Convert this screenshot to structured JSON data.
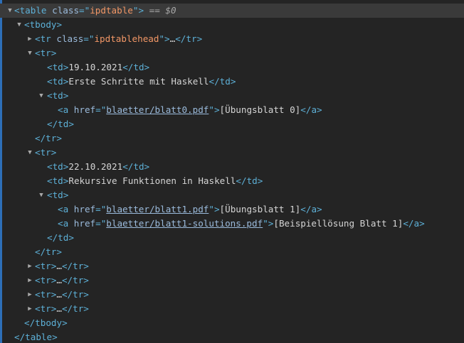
{
  "tree": {
    "table_open": {
      "tag": "table",
      "attr_name": "class",
      "attr_value": "ipdtable",
      "eq": "==",
      "ref": "$0"
    },
    "tbody_open": "tbody",
    "thead_row": {
      "tag": "tr",
      "attr_name": "class",
      "attr_value": "ipdtablehead",
      "ellipsis": "…",
      "close_tag": "tr"
    },
    "row1": {
      "tag": "tr",
      "date": "19.10.2021",
      "title": "Erste Schritte mit Haskell",
      "td_tag": "td",
      "link": {
        "tag": "a",
        "attr_name": "href",
        "href": "blaetter/blatt0.pdf",
        "text": "[Übungsblatt 0]"
      }
    },
    "row2": {
      "tag": "tr",
      "date": "22.10.2021",
      "title": "Rekursive Funktionen in Haskell",
      "td_tag": "td",
      "link1": {
        "tag": "a",
        "attr_name": "href",
        "href": "blaetter/blatt1.pdf",
        "text": "[Übungsblatt 1]"
      },
      "link2": {
        "tag": "a",
        "attr_name": "href",
        "href": "blaetter/blatt1-solutions.pdf",
        "text": "[Beispiellösung Blatt 1]"
      }
    },
    "collapsed_rows": [
      {
        "tag": "tr",
        "ellipsis": "…"
      },
      {
        "tag": "tr",
        "ellipsis": "…"
      },
      {
        "tag": "tr",
        "ellipsis": "…"
      },
      {
        "tag": "tr",
        "ellipsis": "…"
      }
    ],
    "tbody_close": "tbody",
    "table_close": "table"
  },
  "icons": {
    "expanded": "triangle-down-icon",
    "collapsed": "triangle-right-icon"
  },
  "colors": {
    "background": "#242424",
    "selected_row": "#3a3a3a",
    "tag": "#5db0d7",
    "attribute": "#9bbbdc",
    "attribute_value": "#f29766",
    "text": "#d5d5d5",
    "guide": "#2d6fb8"
  }
}
